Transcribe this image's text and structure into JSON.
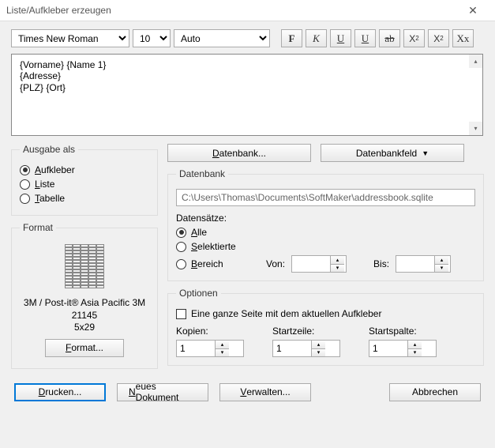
{
  "window": {
    "title": "Liste/Aufkleber erzeugen"
  },
  "toolbar": {
    "font": "Times New Roman",
    "size": "10",
    "color": "Auto",
    "bold": "F",
    "italic": "K",
    "underline": "U",
    "underline2": "U",
    "strike": "ab",
    "sub": "X",
    "sup": "X",
    "caps": "Xx"
  },
  "template": {
    "line1": "{Vorname} {Name 1}",
    "line2": "{Adresse}",
    "line3": "{PLZ} {Ort}"
  },
  "output": {
    "legend": "Ausgabe als",
    "labels": "ufkleber",
    "list": "iste",
    "table": "abelle"
  },
  "format": {
    "legend": "Format",
    "name1": "3M / Post-it®  Asia Pacific 3M",
    "name2": "21145",
    "name3": "5x29",
    "button": "ormat..."
  },
  "db": {
    "button_db": "atenbank...",
    "button_field": "Datenbankfeld",
    "legend": "Datenbank",
    "path": "C:\\Users\\Thomas\\Documents\\SoftMaker\\addressbook.sqlite",
    "records": "Datensätze:",
    "all": "lle",
    "selected": "elektierte",
    "range": "ereich",
    "from": "Von:",
    "to": "Bis:"
  },
  "options": {
    "legend": "Optionen",
    "fullpage": " Eine ganze Seite mit dem aktuellen Aufkleber",
    "copies": "Kopien:",
    "startrow": "Startzeile:",
    "startcol": "Startspalte:",
    "copies_val": "1",
    "startrow_val": "1",
    "startcol_val": "1"
  },
  "bottom": {
    "print": "rucken...",
    "newdoc": "eues Dokument",
    "manage": "erwalten...",
    "cancel": "Abbrechen"
  }
}
